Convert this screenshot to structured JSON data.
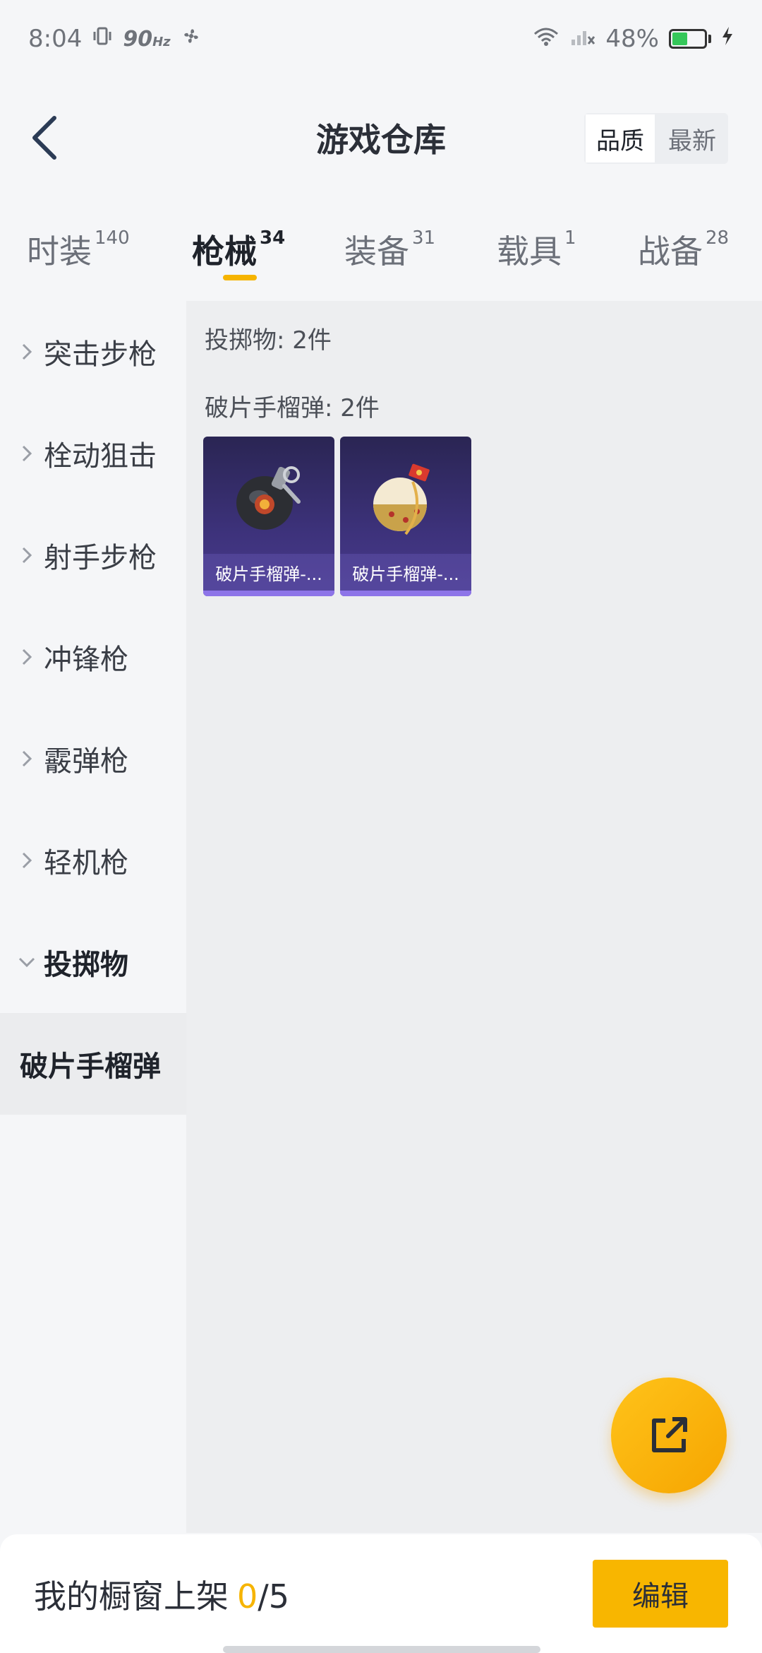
{
  "status": {
    "time": "8:04",
    "hz": "90",
    "hz_unit": "Hz",
    "battery": "48%",
    "battery_level": 0.48
  },
  "header": {
    "title": "游戏仓库",
    "sort_options": [
      "品质",
      "最新"
    ],
    "sort_selected": "品质"
  },
  "tabs": [
    {
      "label": "时装",
      "count": "140"
    },
    {
      "label": "枪械",
      "count": "34",
      "active": true
    },
    {
      "label": "装备",
      "count": "31"
    },
    {
      "label": "载具",
      "count": "1"
    },
    {
      "label": "战备",
      "count": "28"
    }
  ],
  "sidebar": {
    "items": [
      {
        "label": "突击步枪"
      },
      {
        "label": "栓动狙击"
      },
      {
        "label": "射手步枪"
      },
      {
        "label": "冲锋枪"
      },
      {
        "label": "霰弹枪"
      },
      {
        "label": "轻机枪"
      },
      {
        "label": "投掷物",
        "expanded": true
      }
    ],
    "sub_items": [
      {
        "label": "破片手榴弹",
        "selected": true
      }
    ]
  },
  "content": {
    "category_title": "投掷物: 2件",
    "group_title": "破片手榴弹: 2件",
    "cards": [
      {
        "label": "破片手榴弹-..."
      },
      {
        "label": "破片手榴弹-..."
      }
    ]
  },
  "bottom": {
    "showcase_label": "我的橱窗上架",
    "showcase_count": "0",
    "showcase_total": "/5",
    "edit_label": "编辑"
  },
  "colors": {
    "accent": "#f6b400",
    "card_bg": "#3d327b"
  }
}
